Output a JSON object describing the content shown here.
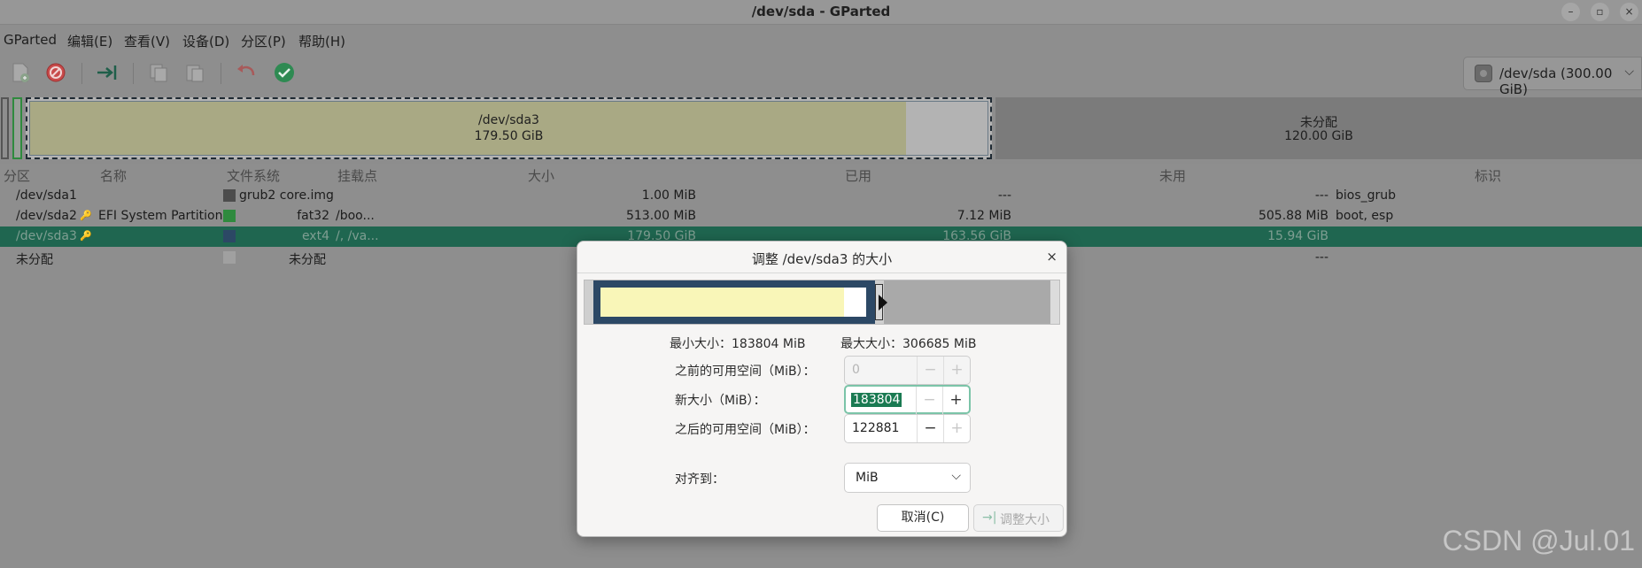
{
  "window": {
    "title": "/dev/sda - GParted",
    "minimize_glyph": "–",
    "restore_glyph": "▫",
    "close_glyph": "×"
  },
  "menubar": [
    "GParted",
    "编辑(E)",
    "查看(V)",
    "设备(D)",
    "分区(P)",
    "帮助(H)"
  ],
  "toolbar": {
    "icons": [
      "new-partition-icon",
      "delete-icon",
      "resize-move-icon",
      "copy-icon",
      "paste-icon",
      "undo-icon",
      "apply-icon"
    ],
    "device": "/dev/sda (300.00 GiB)",
    "device_chevron": "⌵"
  },
  "partition_map": {
    "sda3_name": "/dev/sda3",
    "sda3_size": "179.50 GiB",
    "unalloc_name": "未分配",
    "unalloc_size": "120.00 GiB"
  },
  "table": {
    "headers": [
      "分区",
      "名称",
      "文件系统",
      "挂载点",
      "大小",
      "已用",
      "未用",
      "标识"
    ],
    "rows": [
      {
        "partition": "/dev/sda1",
        "name": "",
        "filesystem": "grub2 core.img",
        "mount": "",
        "size": "1.00 MiB",
        "used": "---",
        "unused": "---",
        "flags": "bios_grub",
        "key": false
      },
      {
        "partition": "/dev/sda2",
        "name": "EFI System Partition",
        "filesystem": "fat32",
        "mount": "/boo...",
        "size": "513.00 MiB",
        "used": "7.12 MiB",
        "unused": "505.88 MiB",
        "flags": "boot, esp",
        "key": true
      },
      {
        "partition": "/dev/sda3",
        "name": "",
        "filesystem": "ext4",
        "mount": "/, /va...",
        "size": "179.50 GiB",
        "used": "163.56 GiB",
        "unused": "15.94 GiB",
        "flags": "",
        "key": true
      },
      {
        "partition": "未分配",
        "name": "",
        "filesystem": "未分配",
        "mount": "",
        "size": "",
        "used": "",
        "unused": "---",
        "flags": "",
        "key": false
      }
    ],
    "colors": {
      "grub": "#4c4c4c",
      "fat32": "#2f8a3e",
      "ext4": "#2c4865",
      "unallocated": "#a0a0a0",
      "selected_row": "#1f6650"
    }
  },
  "dialog": {
    "title": "调整 /dev/sda3 的大小",
    "close_glyph": "×",
    "min_size": "最小大小：183804 MiB",
    "max_size": "最大大小：306685 MiB",
    "free_before_label": "之前的可用空间（MiB）：",
    "free_before_value": "0",
    "new_size_label": "新大小（MiB）：",
    "new_size_value": "183804",
    "free_after_label": "之后的可用空间（MiB）：",
    "free_after_value": "122881",
    "align_label": "对齐到：",
    "align_value": "MiB",
    "cancel_button": "取消(C)",
    "resize_button": "调整大小",
    "minus_glyph": "−",
    "plus_glyph": "+",
    "chevron_glyph": "⌵",
    "resize_icon_glyph": "→|"
  },
  "watermark": "CSDN @Jul.01"
}
